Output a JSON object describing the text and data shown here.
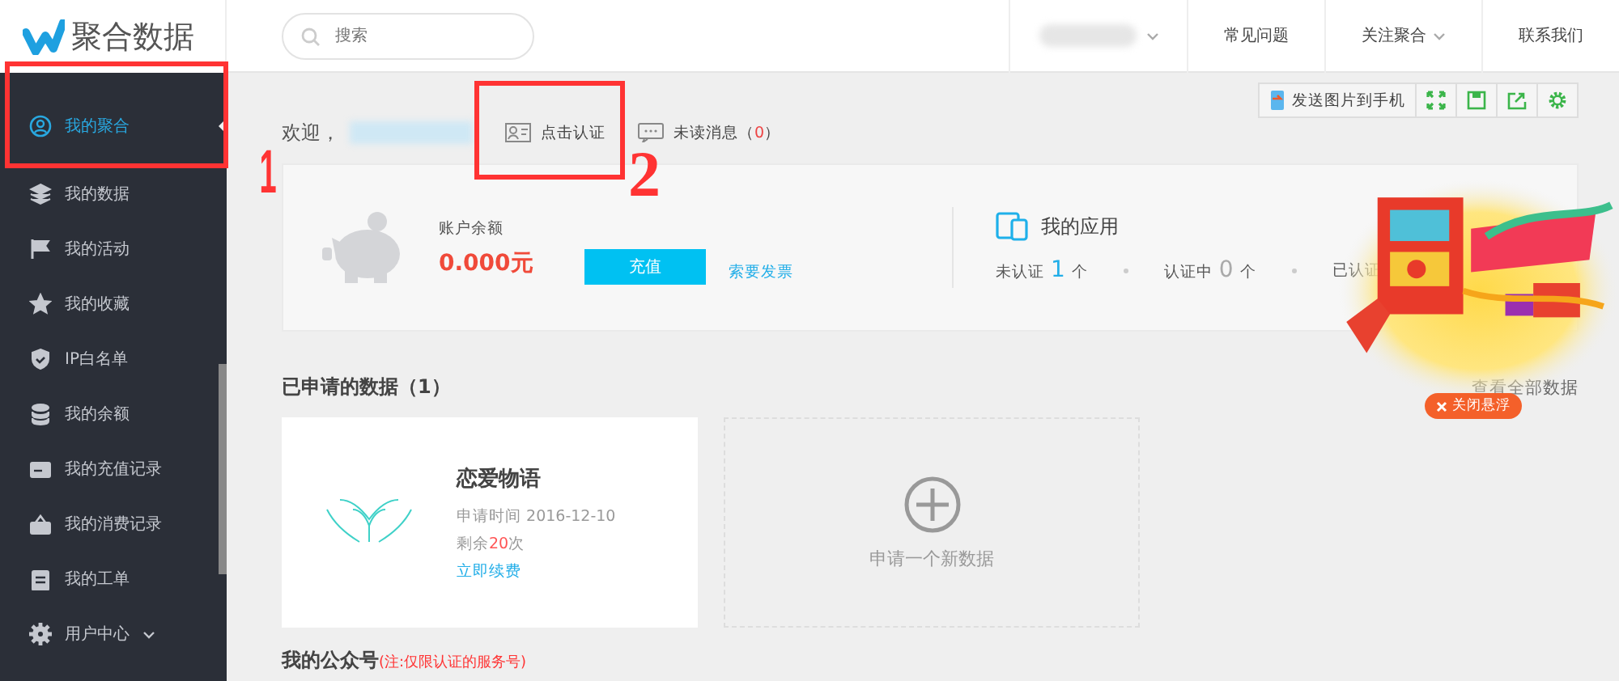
{
  "logo": {
    "text": "聚合数据"
  },
  "search": {
    "placeholder": "搜索"
  },
  "top_nav": [
    {
      "label": "常见问题",
      "dropdown": false
    },
    {
      "label": "关注聚合",
      "dropdown": true
    },
    {
      "label": "联系我们",
      "dropdown": false
    }
  ],
  "sidebar": {
    "items": [
      {
        "label": "我的聚合",
        "selected": true
      },
      {
        "label": "我的数据",
        "selected": false
      },
      {
        "label": "我的活动",
        "selected": false
      },
      {
        "label": "我的收藏",
        "selected": false
      },
      {
        "label": "IP白名单",
        "selected": false
      },
      {
        "label": "我的余额",
        "selected": false
      },
      {
        "label": "我的充值记录",
        "selected": false
      },
      {
        "label": "我的消费记录",
        "selected": false
      },
      {
        "label": "我的工单",
        "selected": false
      },
      {
        "label": "用户中心",
        "selected": false,
        "expandable": true
      }
    ]
  },
  "toolbar": {
    "send_button": "发送图片到手机"
  },
  "welcome": {
    "greeting": "欢迎，",
    "verify_link": "点击认证",
    "messages_label": "未读消息（",
    "messages_count": "0",
    "messages_close": "）"
  },
  "balance": {
    "label": "账户余额",
    "amount_int": "0",
    "amount_rest": ".000元",
    "recharge_button": "充值",
    "invoice_link": "索要发票"
  },
  "apps": {
    "title": "我的应用",
    "stats": [
      {
        "label": "未认证",
        "count": "1",
        "unit": "个",
        "highlight": true
      },
      {
        "label": "认证中",
        "count": "0",
        "unit": "个",
        "highlight": false
      },
      {
        "label": "已认证"
      }
    ]
  },
  "applied": {
    "title": "已申请的数据（1）",
    "view_all": "查看全部数据",
    "cards": [
      {
        "name": "恋爱物语",
        "date": "申请时间 2016-12-10",
        "remaining_prefix": "剩余",
        "remaining_count": "20",
        "remaining_suffix": "次",
        "renew_link": "立即续费"
      }
    ],
    "new_card": "申请一个新数据"
  },
  "public_accounts": {
    "title": "我的公众号",
    "note": "(注:仅限认证的服务号)"
  },
  "promo": {
    "kind": "picture",
    "close_button": "关闭悬浮"
  },
  "annotations": [
    {
      "kind": "box"
    },
    {
      "kind": "box"
    },
    {
      "kind": "number",
      "text": "1"
    },
    {
      "kind": "number",
      "text": "2"
    }
  ]
}
